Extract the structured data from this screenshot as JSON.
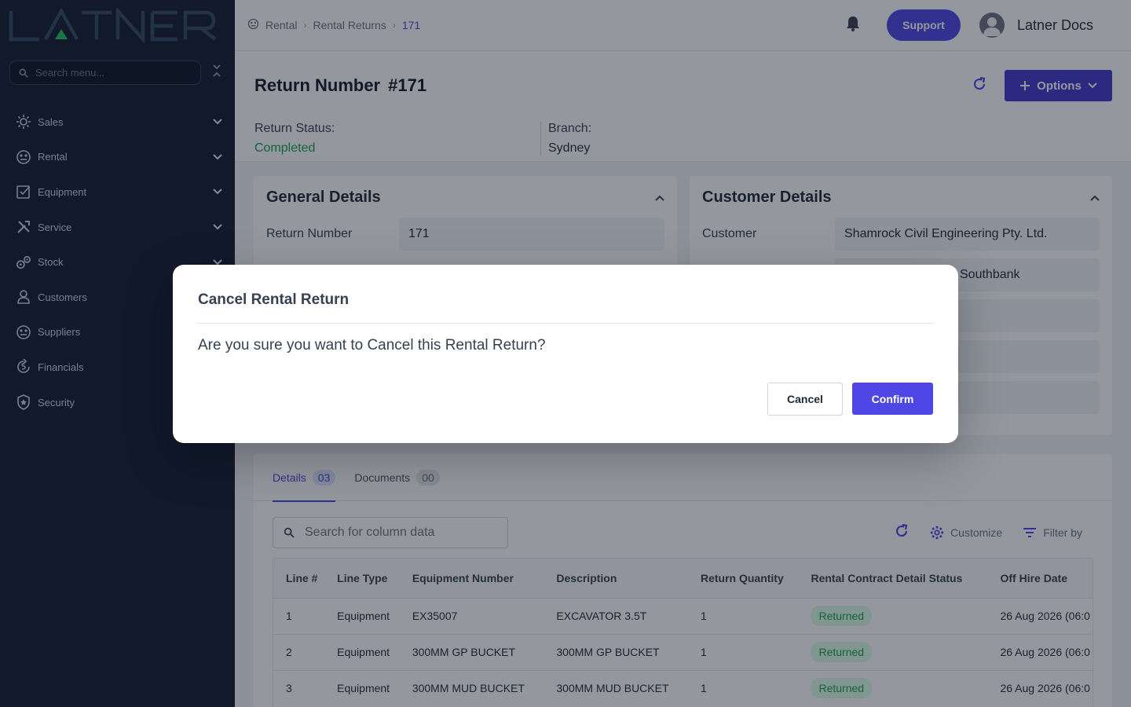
{
  "brand": {
    "logo_text": "LATNER"
  },
  "sidebar": {
    "search_placeholder": "Search menu...",
    "items": [
      {
        "label": "Sales",
        "icon": "sales-icon",
        "has_children": true
      },
      {
        "label": "Rental",
        "icon": "rental-icon",
        "has_children": true
      },
      {
        "label": "Equipment",
        "icon": "equipment-icon",
        "has_children": true
      },
      {
        "label": "Service",
        "icon": "service-icon",
        "has_children": true
      },
      {
        "label": "Stock",
        "icon": "stock-icon",
        "has_children": true
      },
      {
        "label": "Customers",
        "icon": "user-icon",
        "has_children": false
      },
      {
        "label": "Suppliers",
        "icon": "suppliers-icon",
        "has_children": false
      },
      {
        "label": "Financials",
        "icon": "financials-icon",
        "has_children": false
      },
      {
        "label": "Security",
        "icon": "shield-icon",
        "has_children": false
      }
    ]
  },
  "header": {
    "breadcrumbs": [
      "Rental",
      "Rental Returns",
      "171"
    ],
    "support_label": "Support",
    "user_name": "Latner Docs"
  },
  "page": {
    "title_label": "Return Number",
    "title_number": "#171",
    "options_label": "Options",
    "status_label": "Return Status:",
    "status_value": "Completed",
    "branch_label": "Branch:",
    "branch_value": "Sydney"
  },
  "general_details": {
    "title": "General Details",
    "return_number_label": "Return Number",
    "return_number_value": "171"
  },
  "customer_details": {
    "title": "Customer Details",
    "customer_label": "Customer",
    "customer_value": "Shamrock Civil Engineering Pty. Ltd.",
    "partial_value": "Southbank"
  },
  "tabs": [
    {
      "label": "Details",
      "count": "03",
      "active": true
    },
    {
      "label": "Documents",
      "count": "00",
      "active": false
    }
  ],
  "toolbar": {
    "search_placeholder": "Search for column data",
    "customize_label": "Customize",
    "filter_label": "Filter by"
  },
  "table": {
    "columns": [
      "Line #",
      "Line Type",
      "Equipment Number",
      "Description",
      "Return Quantity",
      "Rental Contract Detail Status",
      "Off Hire Date"
    ],
    "rows": [
      [
        "1",
        "Equipment",
        "EX35007",
        "EXCAVATOR 3.5T",
        "1",
        "Returned",
        "26 Aug 2026 (06:0"
      ],
      [
        "2",
        "Equipment",
        "300MM GP BUCKET",
        "300MM GP BUCKET",
        "1",
        "Returned",
        "26 Aug 2026 (06:0"
      ],
      [
        "3",
        "Equipment",
        "300MM MUD BUCKET",
        "300MM MUD BUCKET",
        "1",
        "Returned",
        "26 Aug 2026 (06:0"
      ]
    ]
  },
  "modal": {
    "title": "Cancel Rental Return",
    "message": "Are you sure you want to Cancel this Rental Return?",
    "cancel_label": "Cancel",
    "confirm_label": "Confirm"
  },
  "colors": {
    "sidebar_bg": "#111a2e",
    "accent": "#4f46e5",
    "status_green": "#16a34a"
  }
}
